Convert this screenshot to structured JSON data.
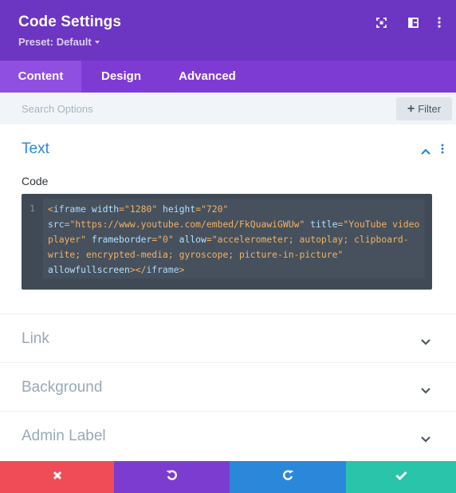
{
  "header": {
    "title": "Code Settings",
    "preset": "Preset: Default",
    "icons": [
      "fullscreen-icon",
      "sidebar-layout-icon",
      "more-vertical-icon"
    ]
  },
  "tabs": [
    {
      "label": "Content",
      "active": true
    },
    {
      "label": "Design",
      "active": false
    },
    {
      "label": "Advanced",
      "active": false
    }
  ],
  "search": {
    "placeholder": "Search Options",
    "filter_label": "Filter"
  },
  "text_section": {
    "title": "Text",
    "code_label": "Code",
    "line_number": "1",
    "code": "<iframe width=\"1280\" height=\"720\" src=\"https://www.youtube.com/embed/FkQuawiGWUw\" title=\"YouTube video player\" frameborder=\"0\" allow=\"accelerometer; autoplay; clipboard-write; encrypted-media; gyroscope; picture-in-picture\" allowfullscreen></iframe>"
  },
  "collapsed_sections": [
    {
      "title": "Link"
    },
    {
      "title": "Background"
    },
    {
      "title": "Admin Label"
    }
  ],
  "footer": {
    "buttons": [
      {
        "name": "cancel",
        "icon": "close-icon",
        "color": "#ef4c58"
      },
      {
        "name": "undo",
        "icon": "undo-icon",
        "color": "#7d3cd0"
      },
      {
        "name": "redo",
        "icon": "redo-icon",
        "color": "#2b87da"
      },
      {
        "name": "save",
        "icon": "check-icon",
        "color": "#29c4a9"
      }
    ]
  },
  "colors": {
    "header_bg": "#6c35c2",
    "tabs_bg": "#7e3bd4",
    "active_tab": "#8f4fe0",
    "accent_blue": "#2b87da",
    "editor_bg": "#3f4a56"
  }
}
